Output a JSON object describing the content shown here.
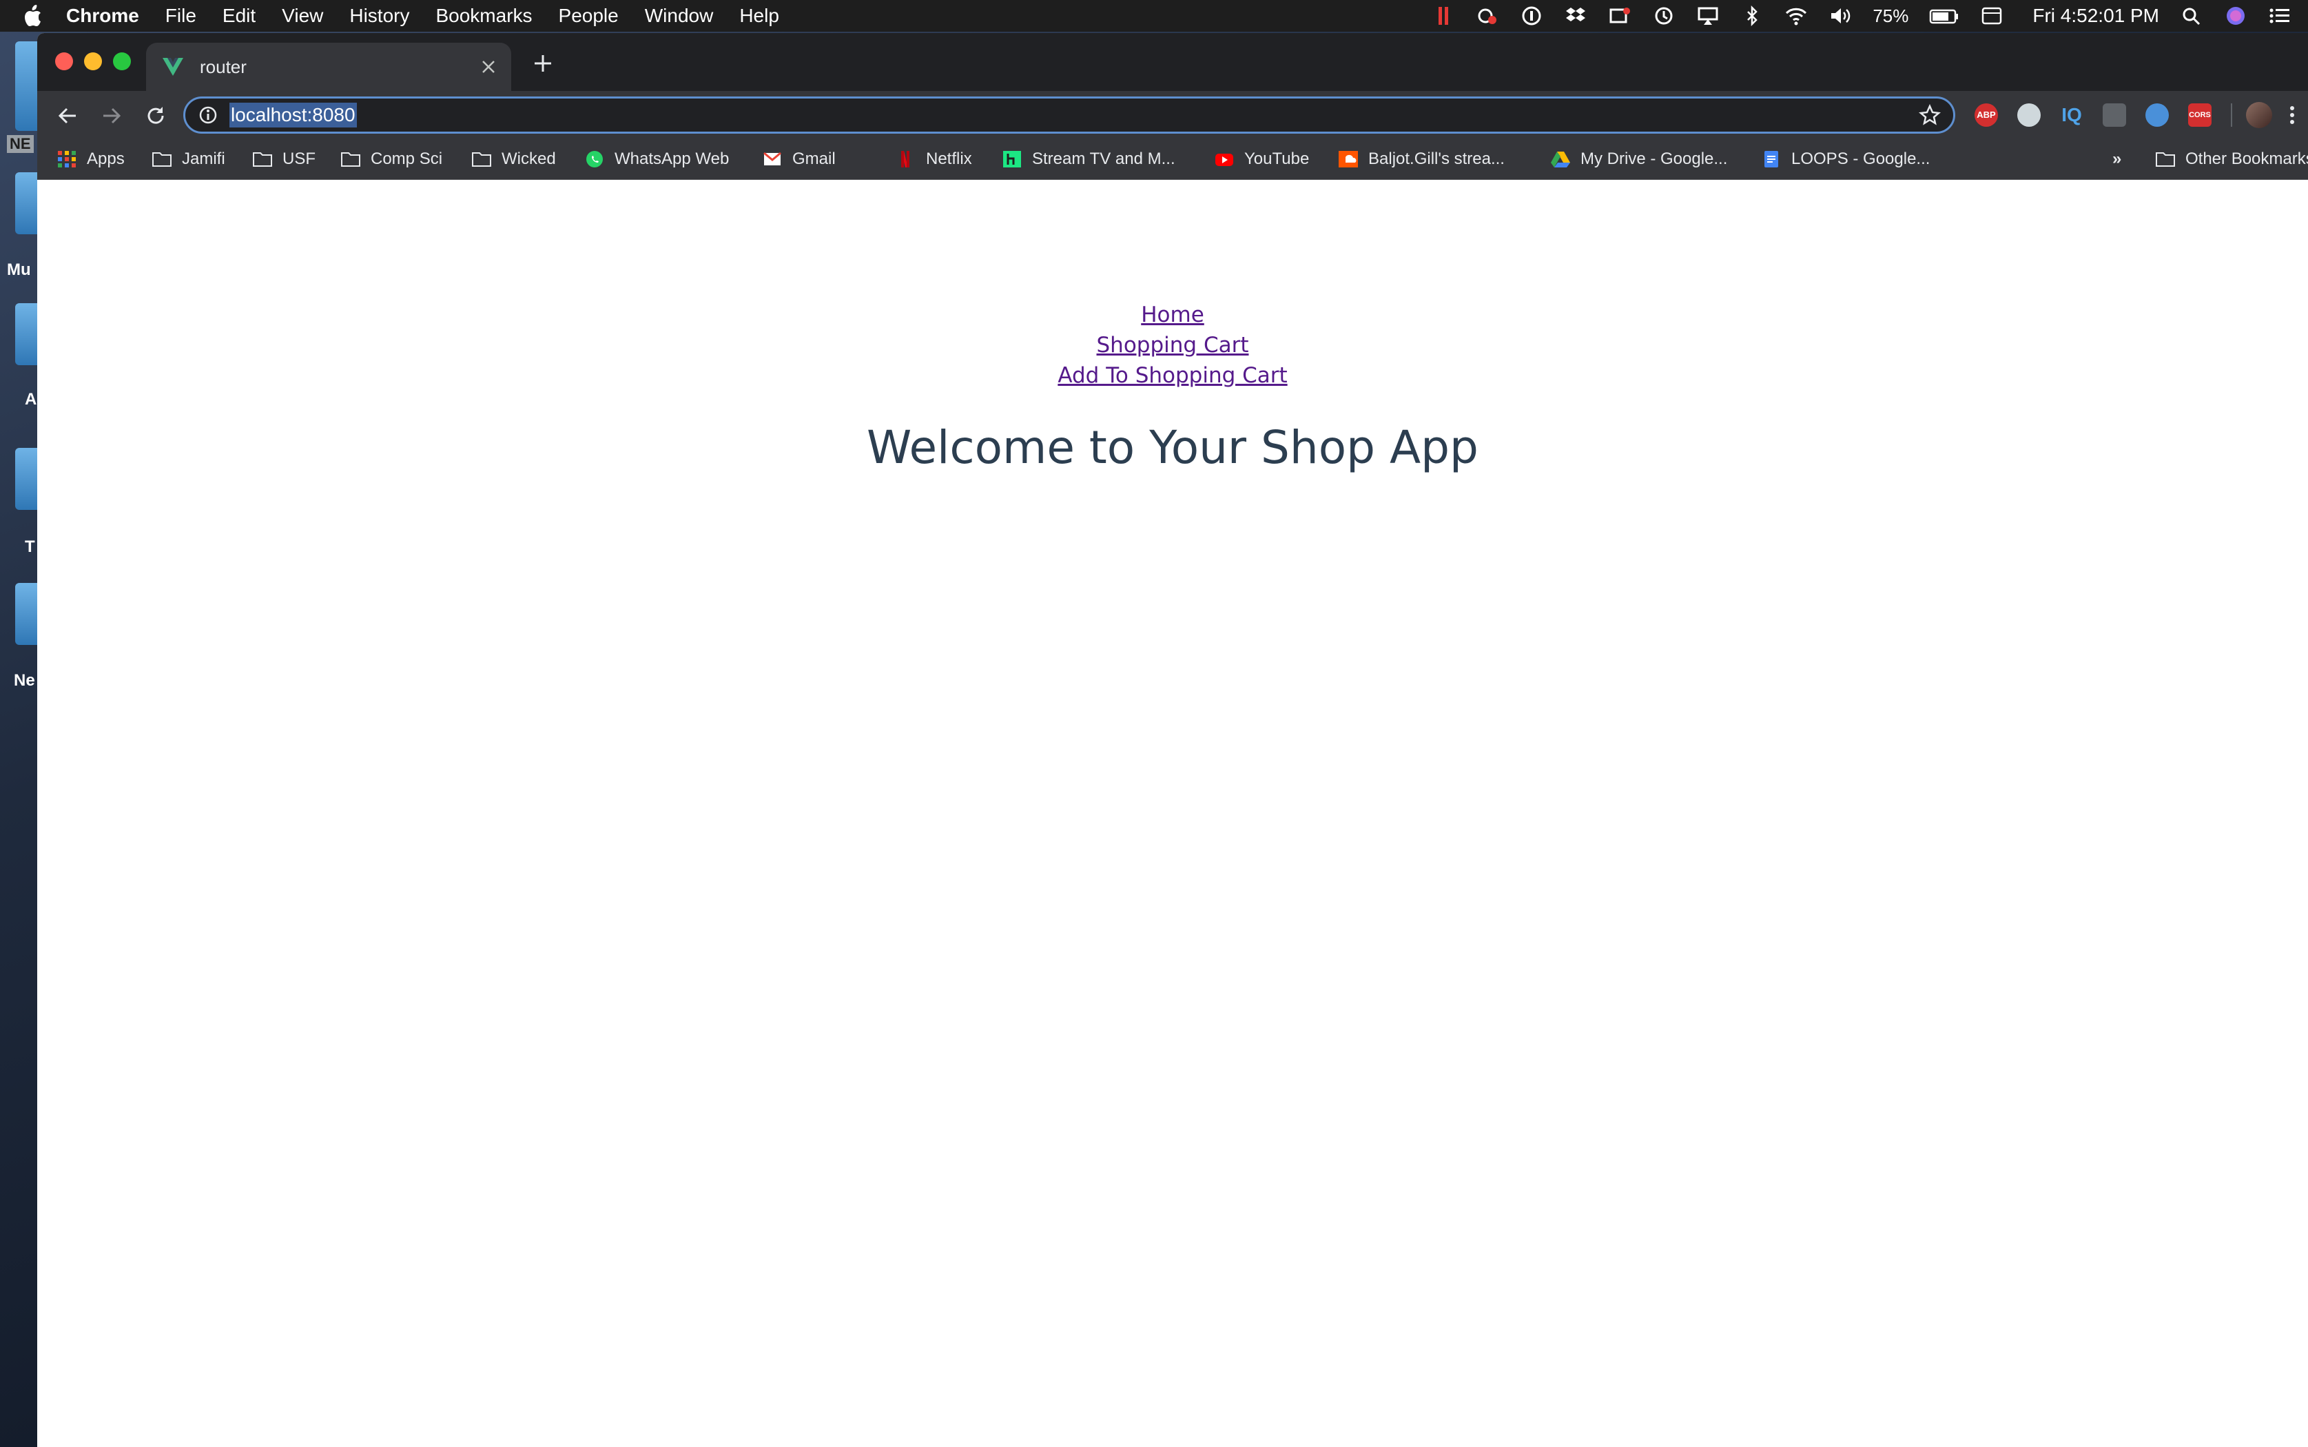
{
  "menubar": {
    "app_name": "Chrome",
    "menus": [
      "File",
      "Edit",
      "View",
      "History",
      "Bookmarks",
      "People",
      "Window",
      "Help"
    ],
    "battery": "75%",
    "clock": "Fri 4:52:01 PM"
  },
  "desktop": {
    "badge": "NE",
    "labels": [
      "Mu",
      "A",
      "T",
      "Ne"
    ]
  },
  "browser": {
    "tab": {
      "title": "router",
      "favicon": "vue-logo-icon"
    },
    "address": {
      "url": "localhost:8080"
    },
    "bookmarks": [
      {
        "label": "Apps",
        "icon": "apps-grid-icon"
      },
      {
        "label": "Jamifi",
        "icon": "folder-icon"
      },
      {
        "label": "USF",
        "icon": "folder-icon"
      },
      {
        "label": "Comp Sci",
        "icon": "folder-icon"
      },
      {
        "label": "Wicked",
        "icon": "folder-icon"
      },
      {
        "label": "WhatsApp Web",
        "icon": "whatsapp-icon"
      },
      {
        "label": "Gmail",
        "icon": "gmail-icon"
      },
      {
        "label": "Netflix",
        "icon": "netflix-icon"
      },
      {
        "label": "Stream TV and M...",
        "icon": "hulu-icon"
      },
      {
        "label": "YouTube",
        "icon": "youtube-icon"
      },
      {
        "label": "Baljot.Gill's strea...",
        "icon": "soundcloud-icon"
      },
      {
        "label": "My Drive - Google...",
        "icon": "google-drive-icon"
      },
      {
        "label": "LOOPS - Google...",
        "icon": "google-docs-icon"
      }
    ],
    "overflow": "»",
    "other_bookmarks": "Other Bookmarks",
    "extensions": [
      "adblock-icon",
      "extension-icon",
      "iq-icon",
      "lightbulb-icon",
      "ghostery-icon",
      "cors-icon"
    ]
  },
  "page": {
    "nav_links": [
      "Home",
      "Shopping Cart",
      "Add To Shopping Cart"
    ],
    "heading": "Welcome to Your Shop App"
  },
  "colors": {
    "link": "#551a8b",
    "heading": "#2c3e50",
    "chrome_dark": "#35363a"
  }
}
